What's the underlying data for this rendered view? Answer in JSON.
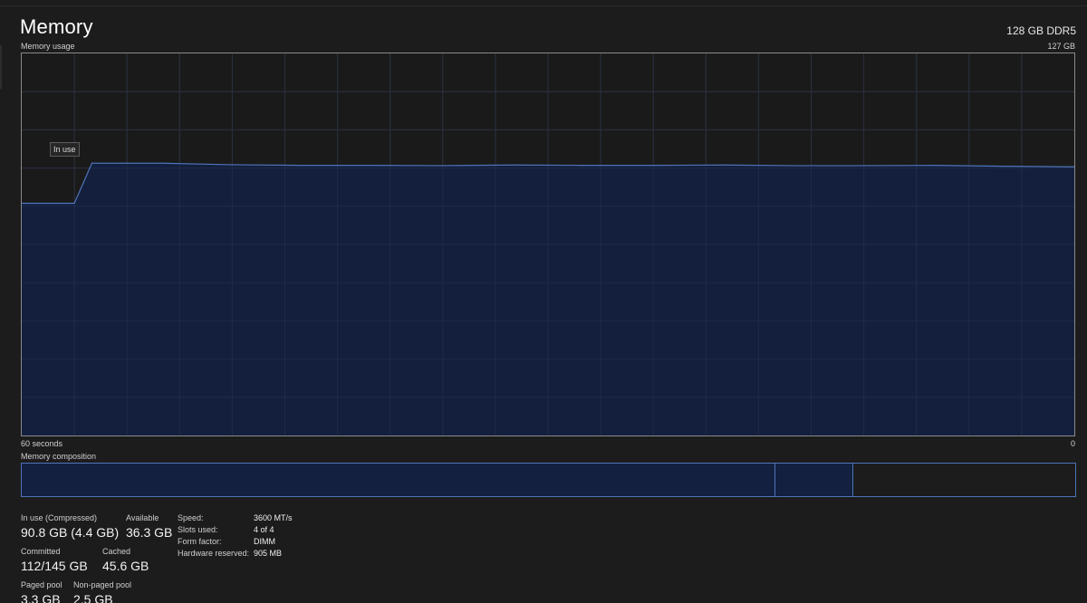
{
  "header": {
    "title": "Memory",
    "spec": "128 GB DDR5"
  },
  "graph": {
    "label": "Memory usage",
    "max_label": "127 GB",
    "time_label": "60 seconds",
    "zero_label": "0",
    "tooltip": "In use",
    "line_color": "#4e74b8",
    "fill_color": "#13203f"
  },
  "chart_data": {
    "type": "area",
    "title": "Memory usage",
    "xlabel": "60 seconds",
    "ylabel": "",
    "xlim": [
      60,
      0
    ],
    "ylim": [
      0,
      127
    ],
    "grid": true,
    "x": [
      60,
      57,
      56,
      52,
      48,
      44,
      40,
      36,
      32,
      28,
      24,
      20,
      16,
      12,
      8,
      4,
      0
    ],
    "series": [
      {
        "name": "In use",
        "values": [
          77.2,
          77.2,
          90.5,
          90.5,
          90.0,
          89.8,
          89.8,
          89.7,
          89.9,
          89.8,
          89.8,
          89.9,
          89.7,
          89.7,
          89.8,
          89.5,
          89.3
        ]
      }
    ]
  },
  "composition": {
    "label": "Memory composition",
    "segments": [
      {
        "name": "In use",
        "fraction": 0.715
      },
      {
        "name": "Cached",
        "fraction": 0.074
      },
      {
        "name": "Free",
        "fraction": 0.211
      }
    ]
  },
  "stats": {
    "in_use_label": "In use (Compressed)",
    "in_use_value": "90.8 GB (4.4 GB)",
    "available_label": "Available",
    "available_value": "36.3 GB",
    "committed_label": "Committed",
    "committed_value": "112/145 GB",
    "cached_label": "Cached",
    "cached_value": "45.6 GB",
    "paged_label": "Paged pool",
    "paged_value": "3.3 GB",
    "nonpaged_label": "Non-paged pool",
    "nonpaged_value": "2.5 GB"
  },
  "details": {
    "speed_label": "Speed:",
    "speed_value": "3600 MT/s",
    "slots_label": "Slots used:",
    "slots_value": "4 of 4",
    "form_label": "Form factor:",
    "form_value": "DIMM",
    "reserved_label": "Hardware reserved:",
    "reserved_value": "905 MB"
  }
}
